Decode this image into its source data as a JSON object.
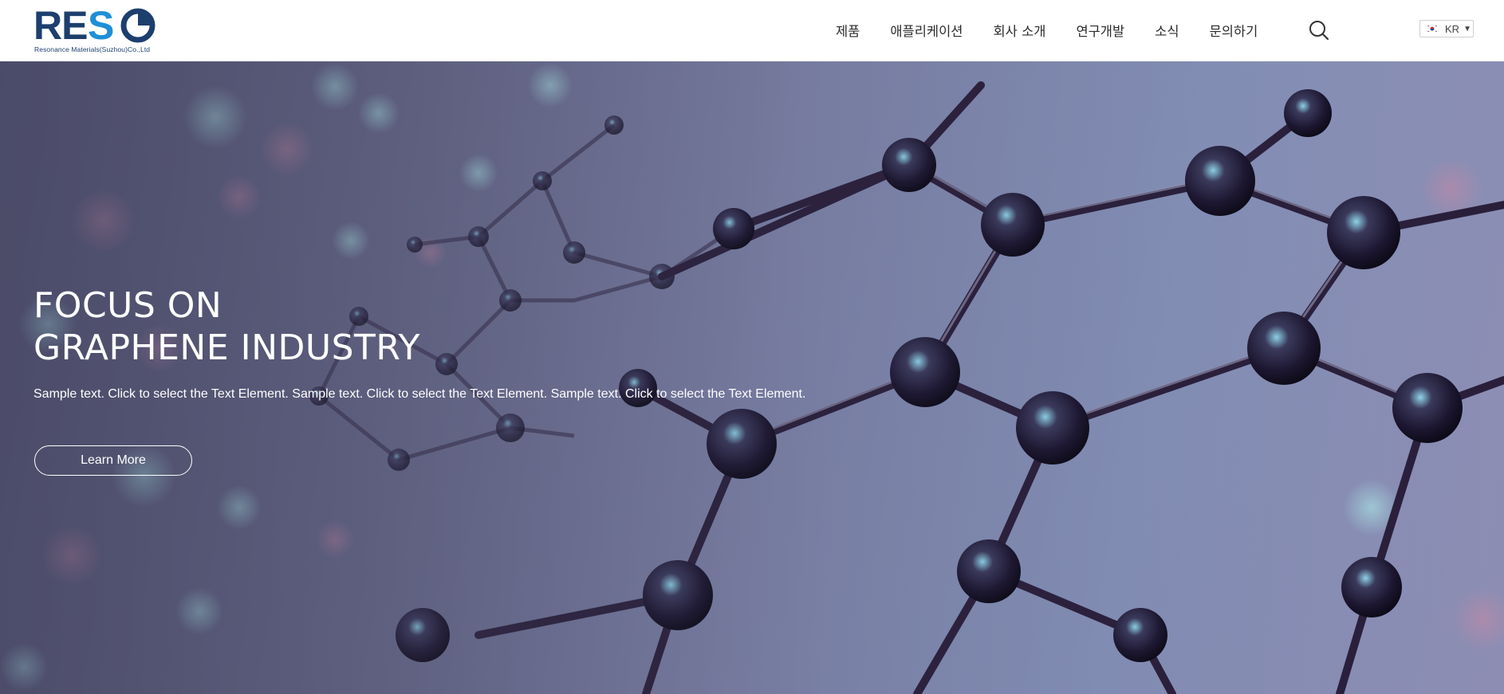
{
  "header": {
    "logo_text": "RESO",
    "logo_subtitle": "Resonance Materials(Suzhou)Co.,Ltd",
    "nav": [
      {
        "label": "제품"
      },
      {
        "label": "애플리케이션"
      },
      {
        "label": "회사 소개"
      },
      {
        "label": "연구개발"
      },
      {
        "label": "소식"
      },
      {
        "label": "문의하기"
      }
    ],
    "search_icon": "search-icon",
    "language": {
      "code": "KR",
      "flag_icon": "korea-flag-icon"
    }
  },
  "hero": {
    "title_line1": "FOCUS ON",
    "title_line2": "GRAPHENE INDUSTRY",
    "text": "Sample text. Click to select the Text Element. Sample text. Click to select the Text Element. Sample text. Click to select the Text Element.",
    "button_label": "Learn More"
  },
  "colors": {
    "brand_navy": "#1d3f6e",
    "brand_blue": "#1f8fd6",
    "hero_tint": "#7d83a8"
  }
}
